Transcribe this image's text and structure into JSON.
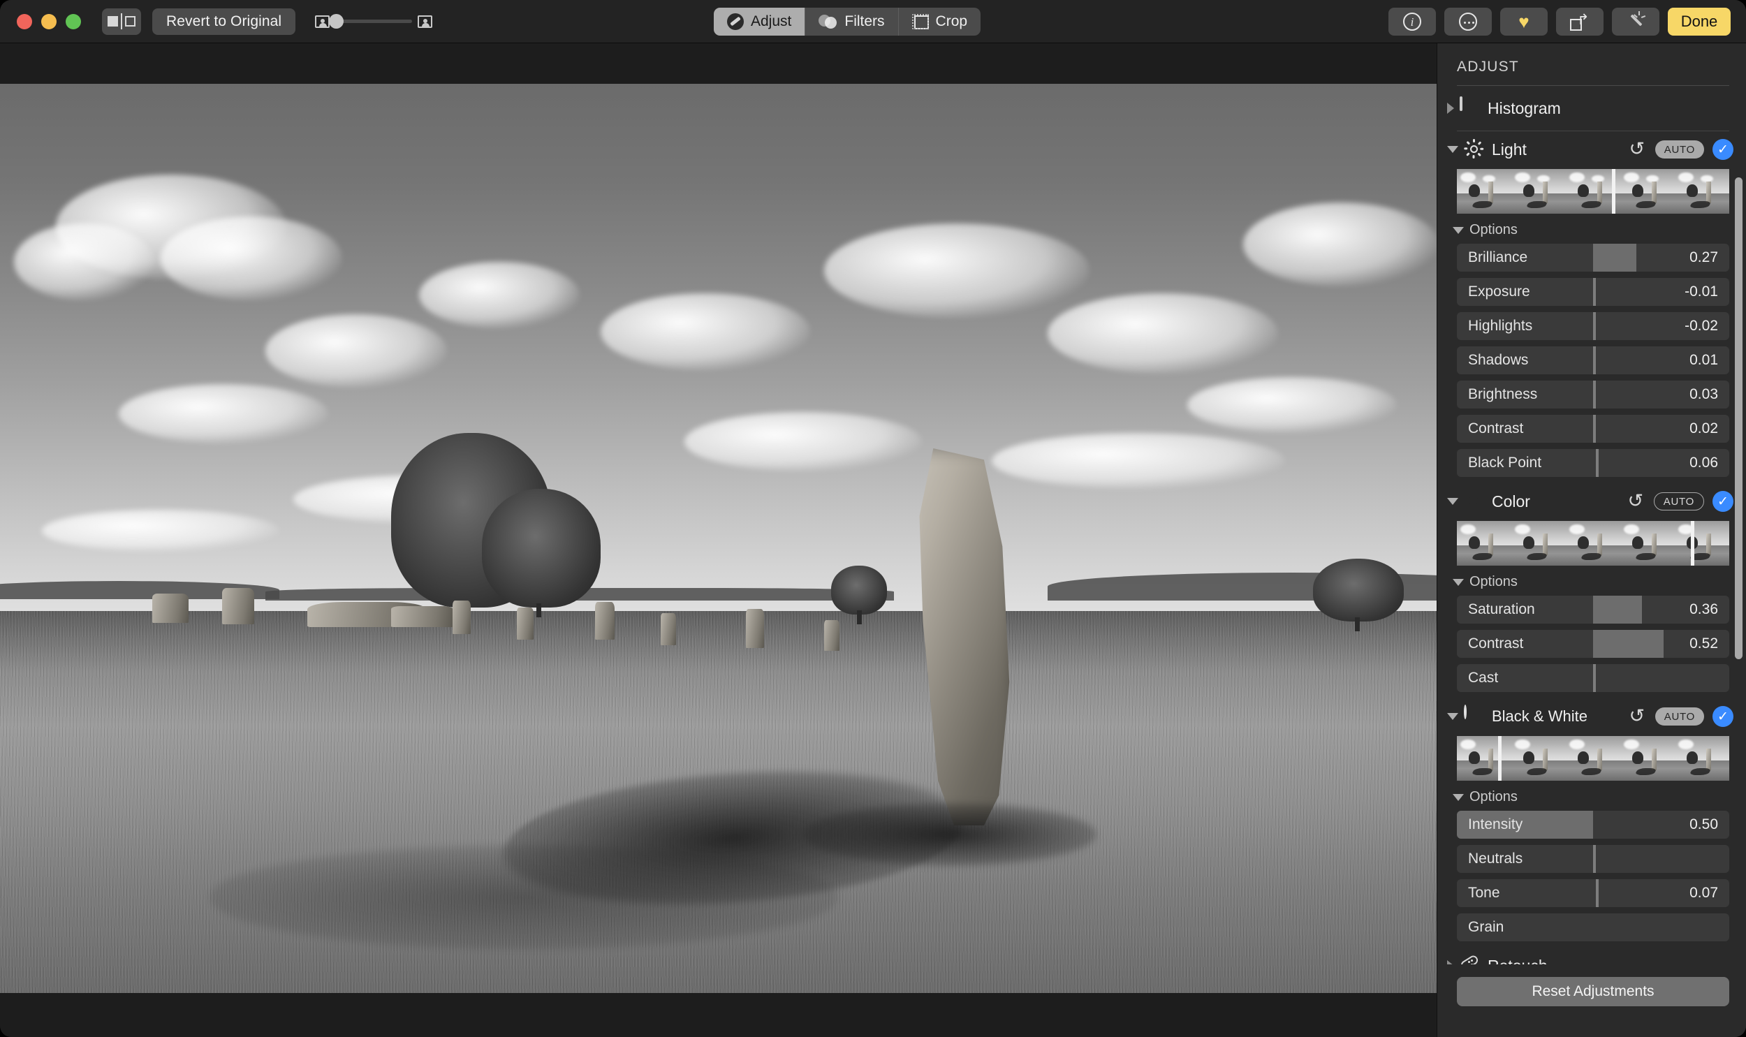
{
  "window": {
    "traffic_lights": [
      "close",
      "minimize",
      "zoom"
    ],
    "colors": {
      "accent_yellow": "#f7d767",
      "accent_blue": "#3a8bff",
      "panel_bg": "#2a2a2a"
    }
  },
  "toolbar": {
    "sidebar_toggle_name": "sidebar-toggle-icon",
    "revert_label": "Revert to Original",
    "compare": {
      "left_icon": "portrait-icon",
      "right_icon": "portrait-icon",
      "value": 8
    },
    "segments": [
      {
        "label": "Adjust",
        "icon": "adjust-icon",
        "active": true
      },
      {
        "label": "Filters",
        "icon": "filters-icon",
        "active": false
      },
      {
        "label": "Crop",
        "icon": "crop-icon",
        "active": false
      }
    ],
    "right_buttons": [
      {
        "name": "info-button",
        "icon": "info-icon",
        "label": "i"
      },
      {
        "name": "more-button",
        "icon": "ellipsis-icon",
        "label": ""
      },
      {
        "name": "favorite-button",
        "icon": "heart-icon",
        "label": "♥"
      },
      {
        "name": "rotate-button",
        "icon": "rotate-icon",
        "label": ""
      },
      {
        "name": "auto-enhance-button",
        "icon": "magic-wand-icon",
        "label": ""
      }
    ],
    "done_label": "Done"
  },
  "panel": {
    "title": "ADJUST",
    "reset_label": "Reset Adjustments",
    "options_label": "Options",
    "auto_label": "AUTO",
    "sections": [
      {
        "id": "histogram",
        "label": "Histogram",
        "icon": "histogram-icon",
        "expanded": false,
        "has_controls": false
      },
      {
        "id": "light",
        "label": "Light",
        "icon": "sun-icon",
        "expanded": true,
        "auto_style": "filled",
        "enabled": true,
        "strip_marker_pct": 57,
        "sliders": [
          {
            "name": "Brilliance",
            "value": "0.27",
            "fill_start_pct": 50,
            "fill_width_pct": 16,
            "tick_pct": null
          },
          {
            "name": "Exposure",
            "value": "-0.01",
            "fill_start_pct": null,
            "fill_width_pct": 0,
            "tick_pct": 50
          },
          {
            "name": "Highlights",
            "value": "-0.02",
            "fill_start_pct": null,
            "fill_width_pct": 0,
            "tick_pct": 50
          },
          {
            "name": "Shadows",
            "value": "0.01",
            "fill_start_pct": null,
            "fill_width_pct": 0,
            "tick_pct": 50
          },
          {
            "name": "Brightness",
            "value": "0.03",
            "fill_start_pct": null,
            "fill_width_pct": 0,
            "tick_pct": 50
          },
          {
            "name": "Contrast",
            "value": "0.02",
            "fill_start_pct": null,
            "fill_width_pct": 0,
            "tick_pct": 50
          },
          {
            "name": "Black Point",
            "value": "0.06",
            "fill_start_pct": null,
            "fill_width_pct": 0,
            "tick_pct": 51
          }
        ]
      },
      {
        "id": "color",
        "label": "Color",
        "icon": "color-wheel-icon",
        "expanded": true,
        "auto_style": "outline",
        "enabled": true,
        "strip_marker_pct": 86,
        "sliders": [
          {
            "name": "Saturation",
            "value": "0.36",
            "fill_start_pct": 50,
            "fill_width_pct": 18,
            "tick_pct": null
          },
          {
            "name": "Contrast",
            "value": "0.52",
            "fill_start_pct": 50,
            "fill_width_pct": 26,
            "tick_pct": null
          },
          {
            "name": "Cast",
            "value": "",
            "fill_start_pct": null,
            "fill_width_pct": 0,
            "tick_pct": 50
          }
        ]
      },
      {
        "id": "black-and-white",
        "label": "Black & White",
        "icon": "contrast-circle-icon",
        "expanded": true,
        "auto_style": "filled",
        "enabled": true,
        "strip_marker_pct": 15,
        "sliders": [
          {
            "name": "Intensity",
            "value": "0.50",
            "fill_start_pct": 0,
            "fill_width_pct": 50,
            "tick_pct": null
          },
          {
            "name": "Neutrals",
            "value": "",
            "fill_start_pct": null,
            "fill_width_pct": 0,
            "tick_pct": 50
          },
          {
            "name": "Tone",
            "value": "0.07",
            "fill_start_pct": null,
            "fill_width_pct": 0,
            "tick_pct": 51
          },
          {
            "name": "Grain",
            "value": "",
            "fill_start_pct": null,
            "fill_width_pct": 0,
            "tick_pct": null
          }
        ]
      },
      {
        "id": "retouch",
        "label": "Retouch",
        "icon": "bandage-icon",
        "expanded": false,
        "has_controls": false
      }
    ]
  },
  "photo": {
    "description": "Black and white photograph of a large standing stone (menhir) in a grassy field with trees and dramatic clouds",
    "alt": "Avebury standing stones"
  }
}
